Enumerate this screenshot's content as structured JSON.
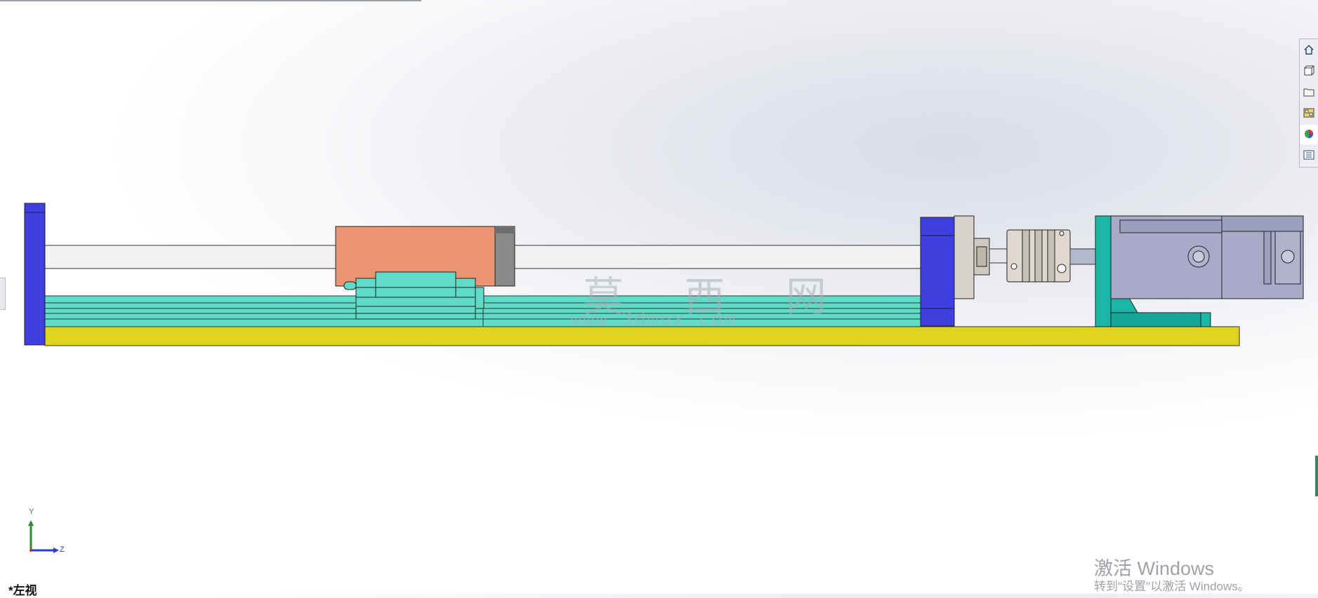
{
  "window": {
    "title": ""
  },
  "watermark": {
    "name": "莫 西 网",
    "url": "www.3dmox.com"
  },
  "activation": {
    "title": "激活 Windows",
    "subtitle": "转到\"设置\"以激活 Windows。"
  },
  "view": {
    "label": "*左视"
  },
  "triad": {
    "y": "Y",
    "z": "Z"
  },
  "task_pane": {
    "items": [
      {
        "icon": "home-icon"
      },
      {
        "icon": "3d-library-icon"
      },
      {
        "icon": "folder-icon"
      },
      {
        "icon": "view-palette-icon"
      },
      {
        "icon": "appearance-icon"
      },
      {
        "icon": "custom-properties-icon"
      }
    ]
  },
  "colors": {
    "base_plate": "#ded41e",
    "end_plate": "#3f3fe0",
    "carriage": "#ec9471",
    "rail": "#5fdcc8",
    "motor_mount": "#1bb6a5",
    "motor": "#a8aac8"
  }
}
